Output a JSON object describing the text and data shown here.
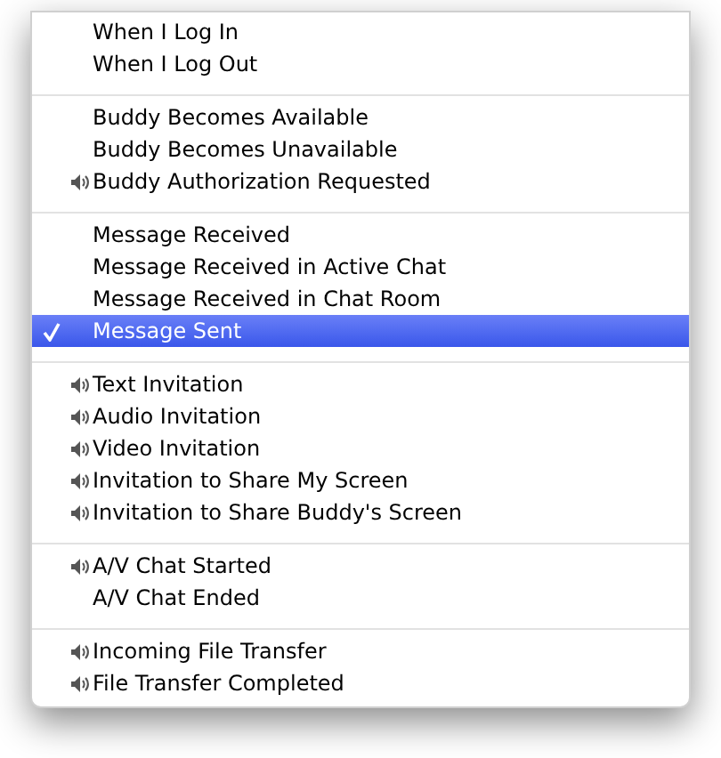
{
  "groups": [
    {
      "items": [
        {
          "label": "When I Log In",
          "sound": false,
          "selected": false
        },
        {
          "label": "When I Log Out",
          "sound": false,
          "selected": false
        }
      ]
    },
    {
      "items": [
        {
          "label": "Buddy Becomes Available",
          "sound": false,
          "selected": false
        },
        {
          "label": "Buddy Becomes Unavailable",
          "sound": false,
          "selected": false
        },
        {
          "label": "Buddy Authorization Requested",
          "sound": true,
          "selected": false
        }
      ]
    },
    {
      "items": [
        {
          "label": "Message Received",
          "sound": false,
          "selected": false
        },
        {
          "label": "Message Received in Active Chat",
          "sound": false,
          "selected": false
        },
        {
          "label": "Message Received in Chat Room",
          "sound": false,
          "selected": false
        },
        {
          "label": "Message Sent",
          "sound": false,
          "selected": true
        }
      ]
    },
    {
      "items": [
        {
          "label": "Text Invitation",
          "sound": true,
          "selected": false
        },
        {
          "label": "Audio Invitation",
          "sound": true,
          "selected": false
        },
        {
          "label": "Video Invitation",
          "sound": true,
          "selected": false
        },
        {
          "label": "Invitation to Share My Screen",
          "sound": true,
          "selected": false
        },
        {
          "label": "Invitation to Share Buddy's Screen",
          "sound": true,
          "selected": false
        }
      ]
    },
    {
      "items": [
        {
          "label": "A/V Chat Started",
          "sound": true,
          "selected": false
        },
        {
          "label": "A/V Chat Ended",
          "sound": false,
          "selected": false
        }
      ]
    },
    {
      "items": [
        {
          "label": "Incoming File Transfer",
          "sound": true,
          "selected": false
        },
        {
          "label": "File Transfer Completed",
          "sound": true,
          "selected": false
        }
      ]
    }
  ]
}
